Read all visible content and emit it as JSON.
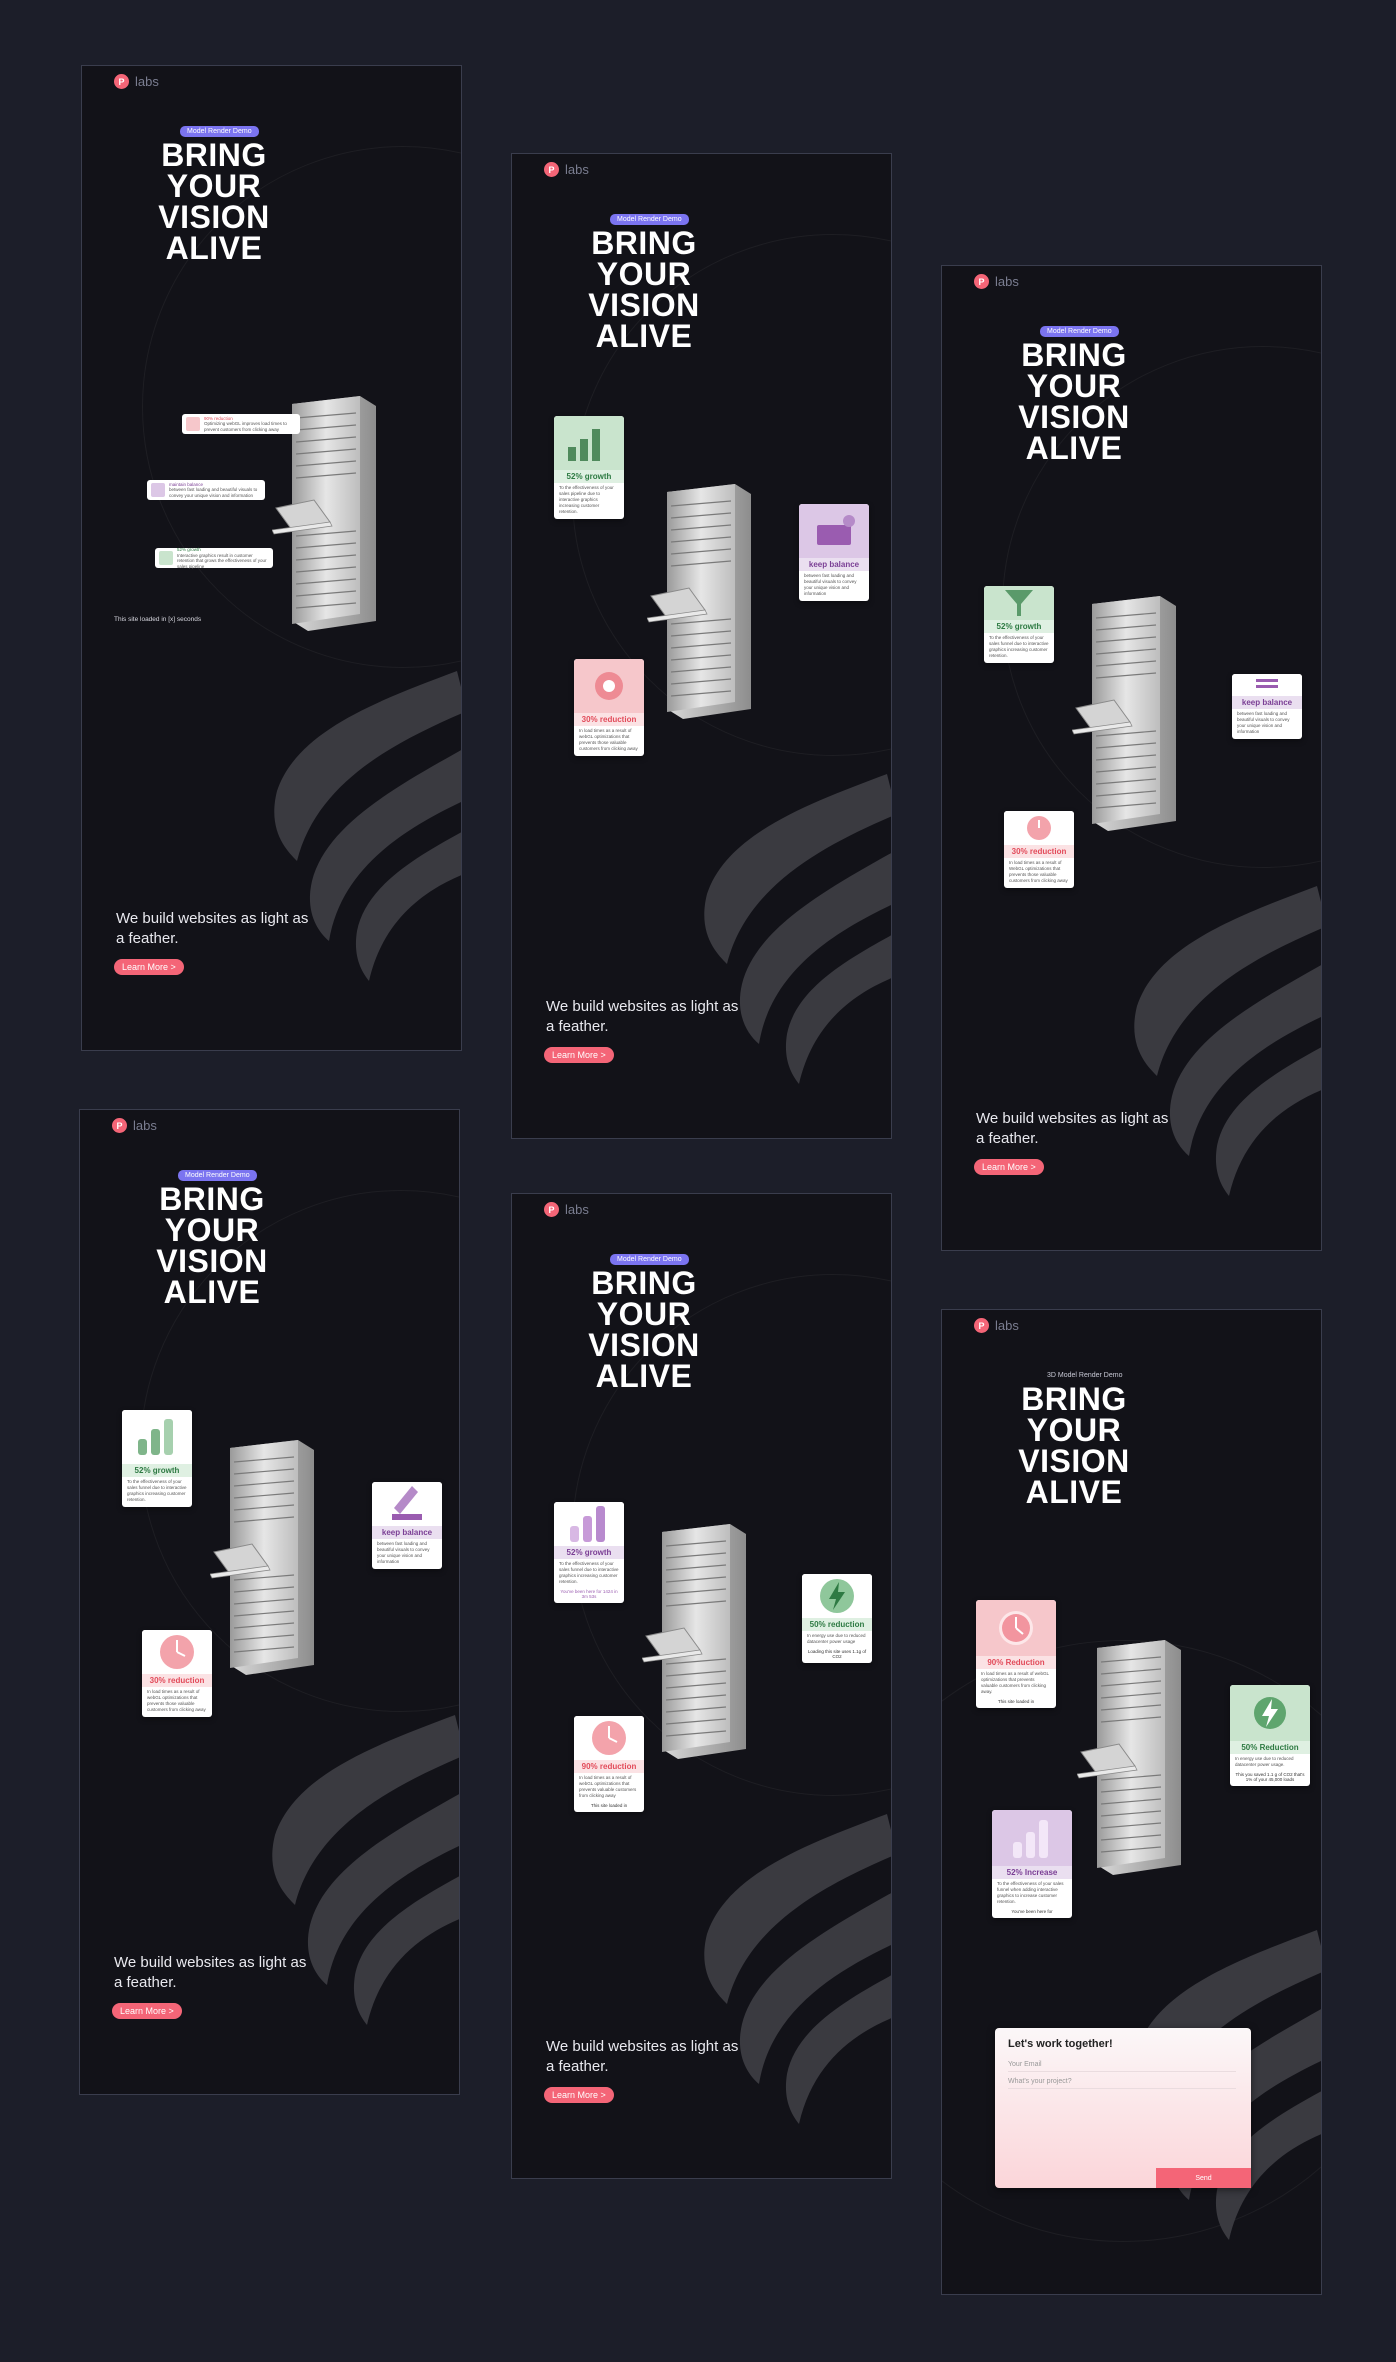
{
  "brand": {
    "logo_letter": "P",
    "logo_text": "labs",
    "accent": "#f46577"
  },
  "screens": [
    {
      "badge": "Model Render Demo",
      "headline": [
        "BRING",
        "YOUR",
        "VISION",
        "ALIVE"
      ],
      "tagline": "We build websites as light as a feather.",
      "cta": "Learn More >",
      "loaded": "This site loaded in [x] seconds",
      "rows": [
        {
          "title": "90% reduction",
          "text": "Optimizing webGL improves load times to prevent customers from clicking away"
        },
        {
          "title": "maintain balance",
          "text": "between fast loading and beautiful visuals to convey your unique vision and information"
        },
        {
          "title": "52% growth",
          "text": "Interactive graphics result in customer retention that grows the effectiveness of your sales pipeline"
        }
      ]
    },
    {
      "badge": "Model Render Demo",
      "headline": [
        "BRING",
        "YOUR",
        "VISION",
        "ALIVE"
      ],
      "tagline": "We build websites as light as a feather.",
      "cta": "Learn More >",
      "cards": [
        {
          "title": "52% growth",
          "text": "To the effectiveness of your sales pipeline due to interactive graphics increasing customer retention."
        },
        {
          "title": "keep balance",
          "text": "between fast loading and beautiful visuals to convey your unique vision and information"
        },
        {
          "title": "30% reduction",
          "text": "In load times as a result of webGL optimizations that prevents those valuable customers from clicking away"
        }
      ]
    },
    {
      "badge": "Model Render Demo",
      "headline": [
        "BRING",
        "YOUR",
        "VISION",
        "ALIVE"
      ],
      "tagline": "We build websites as light as a feather.",
      "cta": "Learn More >",
      "cards": [
        {
          "title": "52% growth",
          "text": "To the effectiveness of your sales funnel due to interactive graphics increasing customer retention."
        },
        {
          "title": "keep balance",
          "text": "between fast loading and beautiful visuals to convey your unique vision and information"
        },
        {
          "title": "30% reduction",
          "text": "In load times as a result of WebGL optimizations that prevents those valuable customers from clicking away"
        }
      ]
    },
    {
      "badge": "Model Render Demo",
      "headline": [
        "BRING",
        "YOUR",
        "VISION",
        "ALIVE"
      ],
      "tagline": "We build websites as light as a feather.",
      "cta": "Learn More >",
      "cards": [
        {
          "title": "52% growth",
          "text": "To the effectiveness of your sales funnel due to interactive graphics increasing customer retention."
        },
        {
          "title": "keep balance",
          "text": "between fast loading and beautiful visuals to convey your unique vision and information"
        },
        {
          "title": "30% reduction",
          "text": "In load times as a result of webGL optimizations that prevents those valuable customers from clicking away"
        }
      ]
    },
    {
      "badge": "Model Render Demo",
      "headline": [
        "BRING",
        "YOUR",
        "VISION",
        "ALIVE"
      ],
      "tagline": "We build websites as light as a feather.",
      "cta": "Learn More >",
      "cards": [
        {
          "title": "52% growth",
          "text": "To the effectiveness of your sales funnel due to interactive graphics increasing customer retention.",
          "sub": "You've been here for 1424 in 3m 53s"
        },
        {
          "title": "50% reduction",
          "text": "In energy use due to reduced datacenter power usage",
          "sub": "Loading this site uses 1.1g of CO2"
        },
        {
          "title": "90% reduction",
          "text": "In load times as a result of webGL optimizations that prevents valuable customers from clicking away",
          "sub": "This site loaded in"
        }
      ]
    },
    {
      "badge": "3D Model Render Demo",
      "headline": [
        "BRING",
        "YOUR",
        "VISION",
        "ALIVE"
      ],
      "cards": [
        {
          "title": "90% Reduction",
          "text": "In load times as a result of webGL optimizations that prevents valuable customers from clicking away.",
          "sub": "This site loaded in"
        },
        {
          "title": "50% Reduction",
          "text": "In energy use due to reduced datacenter power usage.",
          "sub": "This you saved 1.1 g of CO2 that's 1% of your 45,000 loads"
        },
        {
          "title": "52% Increase",
          "text": "To the effectiveness of your sales funnel when adding interactive graphics to increase customer retention.",
          "sub": "You've been here for"
        }
      ],
      "form": {
        "title": "Let's work together!",
        "email_placeholder": "Your Email",
        "project_placeholder": "What's your project?",
        "send": "Send"
      }
    }
  ]
}
